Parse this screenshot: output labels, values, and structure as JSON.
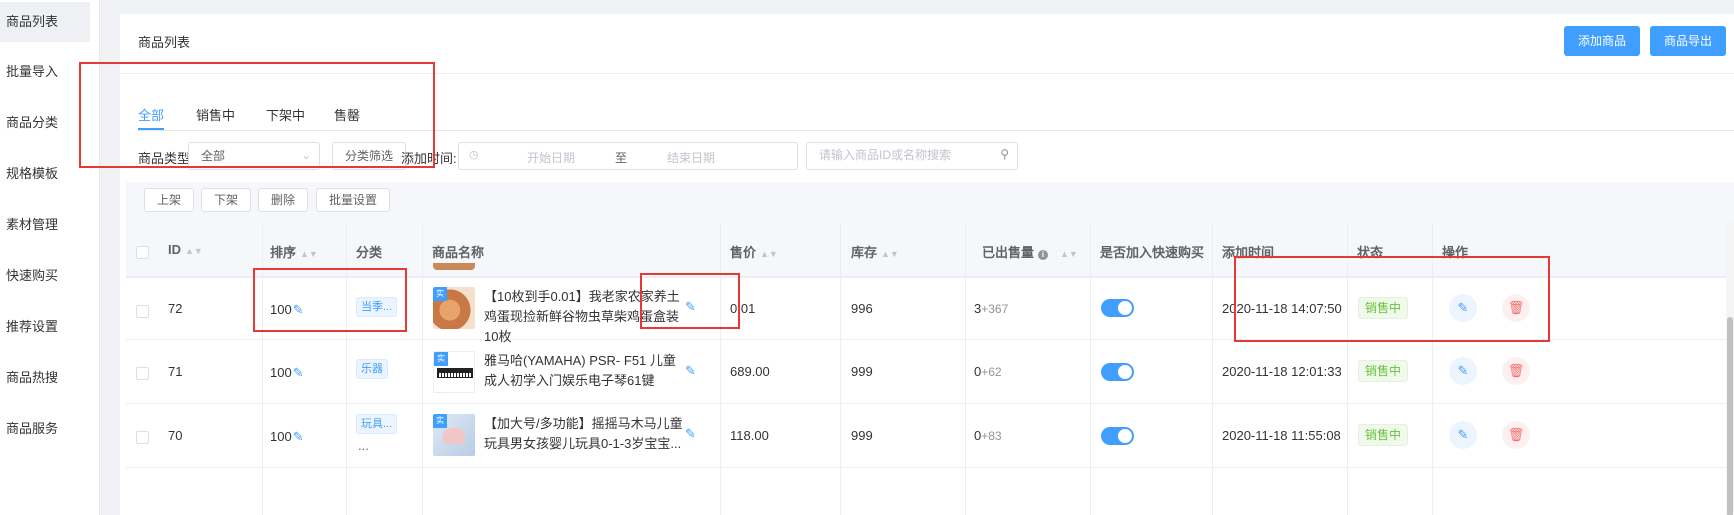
{
  "sidebar": {
    "items": [
      {
        "label": "商品列表",
        "active": true
      },
      {
        "label": "批量导入"
      },
      {
        "label": "商品分类"
      },
      {
        "label": "规格模板"
      },
      {
        "label": "素材管理"
      },
      {
        "label": "快速购买"
      },
      {
        "label": "推荐设置"
      },
      {
        "label": "商品热搜"
      },
      {
        "label": "商品服务"
      }
    ]
  },
  "header": {
    "title": "商品列表",
    "add_button": "添加商品",
    "export_button": "商品导出"
  },
  "tabs": [
    {
      "label": "全部",
      "active": true
    },
    {
      "label": "销售中"
    },
    {
      "label": "下架中"
    },
    {
      "label": "售罄"
    }
  ],
  "filters": {
    "type_label": "商品类型:",
    "type_value": "全部",
    "category_button": "分类筛选",
    "time_label": "添加时间:",
    "start_placeholder": "开始日期",
    "range_separator": "至",
    "end_placeholder": "结束日期",
    "search_placeholder": "请输入商品ID或名称搜索"
  },
  "bulk_actions": {
    "on_shelf": "上架",
    "off_shelf": "下架",
    "delete": "删除",
    "batch_settings": "批量设置"
  },
  "table": {
    "columns": [
      "ID",
      "排序",
      "分类",
      "商品名称",
      "售价",
      "库存",
      "已出售量",
      "是否加入快速购买",
      "添加时间",
      "状态",
      "操作"
    ],
    "rows": [
      {
        "id": "72",
        "sort": "100",
        "category": "当季...",
        "name": "【10枚到手0.01】我老家农家养土鸡蛋现捡新鲜谷物虫草柴鸡蛋盒装10枚",
        "price": "0.01",
        "stock": "996",
        "sold_base": "3",
        "sold_extra": "+367",
        "quick_buy": true,
        "added": "2020-11-18 14:07:50",
        "status": "销售中"
      },
      {
        "id": "71",
        "sort": "100",
        "category": "乐器",
        "name": "雅马哈(YAMAHA) PSR- F51 儿童成人初学入门娱乐电子琴61键",
        "price": "689.00",
        "stock": "999",
        "sold_base": "0",
        "sold_extra": "+62",
        "quick_buy": true,
        "added": "2020-11-18 12:01:33",
        "status": "销售中"
      },
      {
        "id": "70",
        "sort": "100",
        "category": "玩具...",
        "category_extra": "...",
        "name": "【加大号/多功能】摇摇马木马儿童玩具男女孩婴儿玩具0-1-3岁宝宝...",
        "price": "118.00",
        "stock": "999",
        "sold_base": "0",
        "sold_extra": "+83",
        "quick_buy": true,
        "added": "2020-11-18 11:55:08",
        "status": "销售中"
      }
    ],
    "thumb_badge": "实"
  },
  "colors": {
    "primary": "#409eff",
    "success": "#67c23a",
    "danger": "#f56c6c",
    "annotation": "#e53935"
  }
}
